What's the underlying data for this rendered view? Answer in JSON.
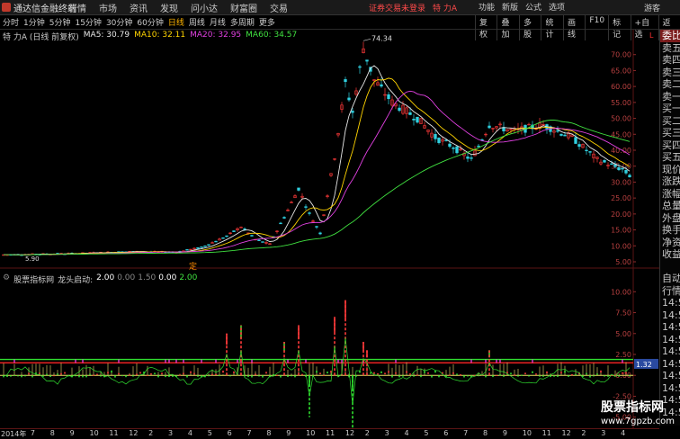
{
  "app": {
    "title": "通达信金融终端"
  },
  "menu": [
    "行情",
    "市场",
    "资讯",
    "发现",
    "问小达",
    "财富圈",
    "交易"
  ],
  "warning": {
    "text": "证券交易未登录",
    "stock": "特 力A"
  },
  "right_menu": [
    "功能",
    "新版",
    "公式",
    "选项"
  ],
  "guest": "游客",
  "periods": [
    "分时",
    "1分钟",
    "5分钟",
    "15分钟",
    "30分钟",
    "60分钟",
    "日线",
    "周线",
    "月线",
    "多周期",
    "更多"
  ],
  "active_period": "日线",
  "tools": [
    "复权",
    "叠加",
    "多股",
    "统计",
    "画线",
    "F10",
    "标记",
    "+自选",
    "返回"
  ],
  "main_chart": {
    "stock_label": "特 力A (日线 前复权)",
    "ma": [
      {
        "label": "MA5: 30.79",
        "color": "#e8e8e8"
      },
      {
        "label": "MA10: 32.11",
        "color": "#ffd400"
      },
      {
        "label": "MA20: 32.95",
        "color": "#e040e0"
      },
      {
        "label": "MA60: 34.57",
        "color": "#40e040"
      }
    ],
    "y_ticks": [
      "70.00",
      "65.00",
      "60.00",
      "55.00",
      "50.00",
      "45.00",
      "40.00",
      "35.00",
      "30.00",
      "25.00",
      "20.00",
      "15.00",
      "10.00",
      "5.00"
    ],
    "y_axis_label": "L",
    "high_label": "74.34",
    "low_label": "5.90",
    "marker_label": "定"
  },
  "sub_chart": {
    "name": "股票指标网",
    "formula": "龙头启动:",
    "values": [
      {
        "label": "2.00",
        "color": "#ffffff"
      },
      {
        "label": "0.00",
        "color": "#888888"
      },
      {
        "label": "1.50",
        "color": "#888888"
      },
      {
        "label": "0.00",
        "color": "#ffffff"
      },
      {
        "label": "2.00",
        "color": "#40e040"
      }
    ],
    "y_ticks": [
      "10.00",
      "7.50",
      "5.00",
      "2.50",
      "0.00",
      "-2.50",
      "-5.00"
    ],
    "current_value": "1.32"
  },
  "x_axis": [
    "2014年",
    "7",
    "8",
    "9",
    "10",
    "11",
    "12",
    "2",
    "3",
    "4",
    "5",
    "6",
    "7",
    "8",
    "9",
    "10",
    "11",
    "12",
    "2",
    "3",
    "4",
    "5",
    "6",
    "7",
    "8",
    "9",
    "10",
    "11",
    "12",
    "2",
    "3",
    "4"
  ],
  "right_panel": [
    "委比",
    "卖五",
    "卖四",
    "卖三",
    "卖二",
    "卖一",
    "买一",
    "买二",
    "买三",
    "买四",
    "买五",
    "现价",
    "涨跌",
    "涨幅",
    "总量",
    "外盘",
    "换手",
    "净资",
    "收益",
    "",
    "自动",
    "行情",
    "14:5",
    "14:5",
    "14:5",
    "14:5",
    "14:5",
    "14:5",
    "14:5",
    "14:5",
    "14:5",
    "14:5"
  ],
  "watermark": {
    "title": "股票指标网",
    "url": "www.7gpzb.com"
  }
}
